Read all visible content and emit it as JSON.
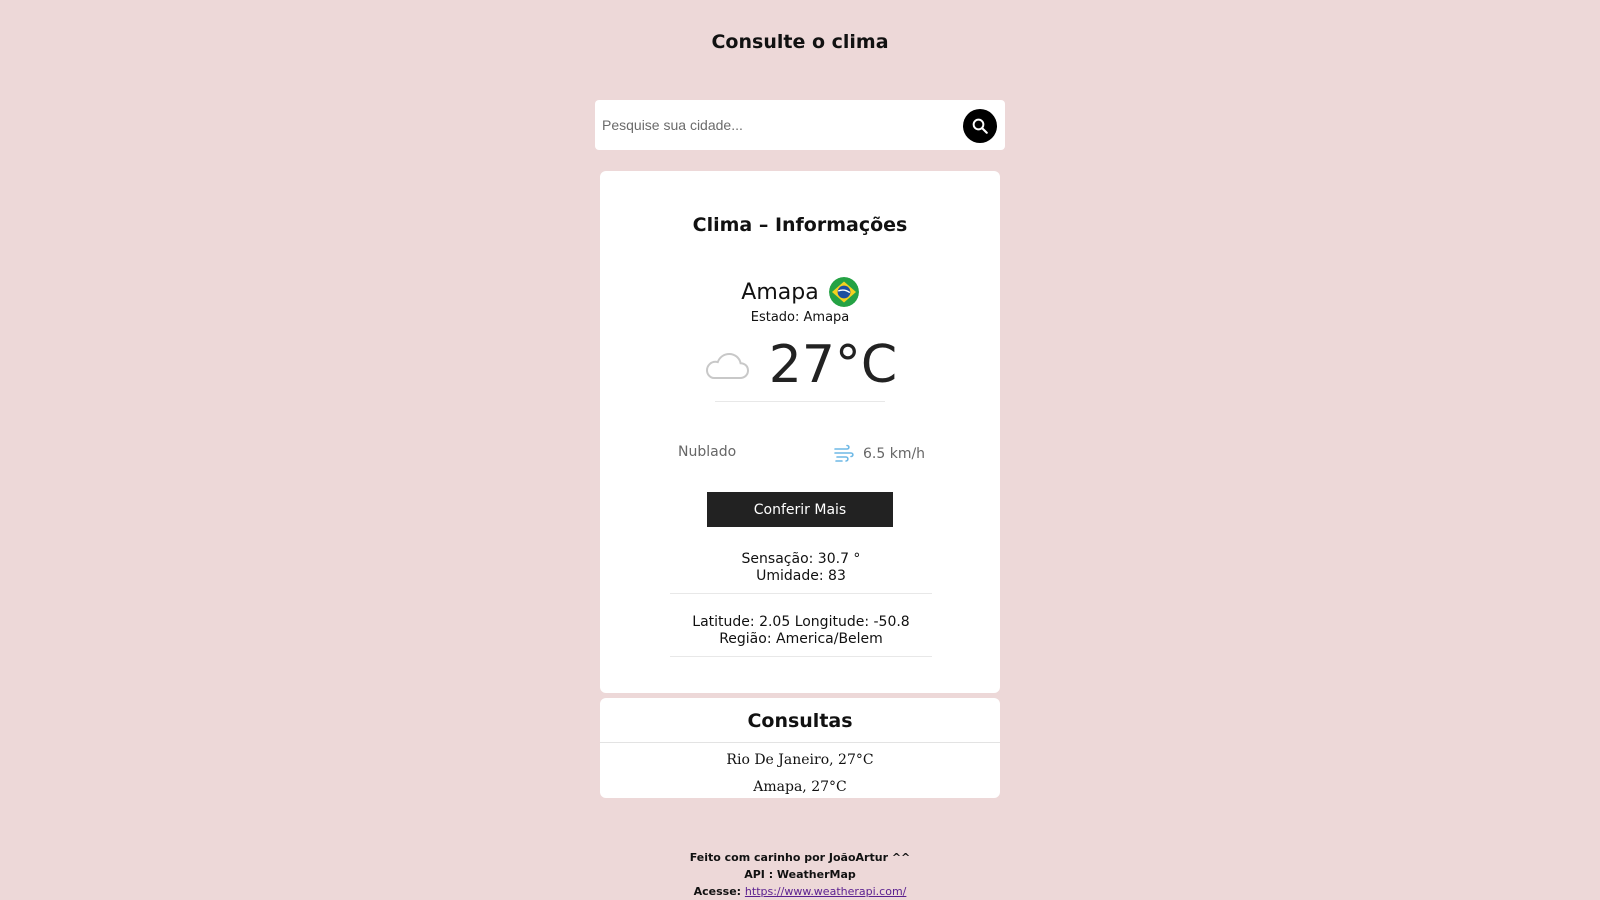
{
  "header": {
    "title": "Consulte o clima"
  },
  "search": {
    "placeholder": "Pesquise sua cidade...",
    "value": "",
    "button_icon": "search-icon"
  },
  "weather_card": {
    "title": "Clima – Informações",
    "city": "Amapa",
    "flag_icon": "brazil-flag-icon",
    "state_label": "Estado:",
    "state_value": "Amapa",
    "temperature": "27°C",
    "weather_icon": "cloud-icon",
    "condition": "Nublado",
    "wind_icon": "wind-icon",
    "wind_speed": "6.5 km/h",
    "more_button_label": "Conferir Mais",
    "details": {
      "feels_like": "Sensação: 30.7 °",
      "humidity": "Umidade: 83",
      "coordinates": "Latitude: 2.05 Longitude: -50.8",
      "region": "Região: America/Belem"
    }
  },
  "history": {
    "title": "Consultas",
    "items": [
      "Rio De Janeiro, 27°C",
      "Amapa, 27°C"
    ]
  },
  "footer": {
    "credit": "Feito com carinho por JoãoArtur ^^",
    "api": "API : WeatherMap",
    "access_label": "Acesse:",
    "link_text": "https://www.weatherapi.com/"
  },
  "colors": {
    "page_background": "#edd8d8",
    "card_background": "#ffffff",
    "button_dark": "#222222",
    "search_button": "#000000",
    "link": "#5a1f8f"
  }
}
